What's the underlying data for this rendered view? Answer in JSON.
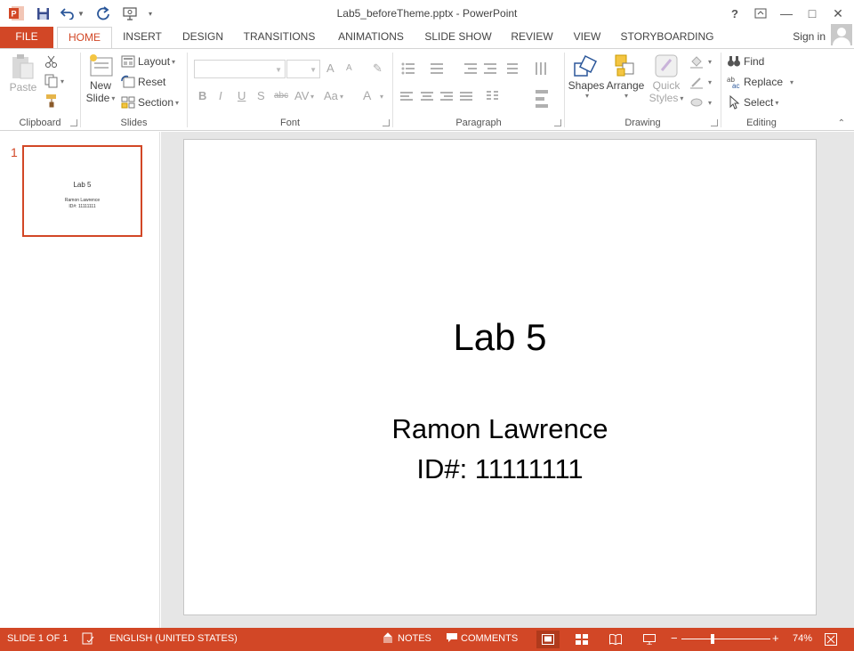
{
  "window": {
    "title": "Lab5_beforeTheme.pptx - PowerPoint",
    "help": "?",
    "minimize": "—",
    "maximize": "□",
    "close": "✕"
  },
  "tabs": [
    "FILE",
    "HOME",
    "INSERT",
    "DESIGN",
    "TRANSITIONS",
    "ANIMATIONS",
    "SLIDE SHOW",
    "REVIEW",
    "VIEW",
    "STORYBOARDING"
  ],
  "active_tab": "HOME",
  "signin": "Sign in",
  "ribbon": {
    "clipboard": {
      "paste": "Paste",
      "label": "Clipboard"
    },
    "slides": {
      "new_slide_line1": "New",
      "new_slide_line2": "Slide",
      "layout": "Layout",
      "reset": "Reset",
      "section": "Section",
      "label": "Slides"
    },
    "font": {
      "label": "Font",
      "bold": "B",
      "italic": "I",
      "underline": "U",
      "shadow": "S",
      "strike": "abc",
      "spacing": "AV",
      "case": "Aa",
      "color": "A",
      "grow": "A",
      "shrink": "A"
    },
    "paragraph": {
      "label": "Paragraph"
    },
    "drawing": {
      "shapes": "Shapes",
      "arrange": "Arrange",
      "quick_line1": "Quick",
      "quick_line2": "Styles",
      "label": "Drawing"
    },
    "editing": {
      "find": "Find",
      "replace": "Replace",
      "select": "Select",
      "label": "Editing"
    }
  },
  "thumbnails": [
    {
      "number": "1",
      "title": "Lab 5",
      "line1": "Ramon Lawrence",
      "line2": "ID#: 11111111"
    }
  ],
  "slide": {
    "title": "Lab 5",
    "subtitle_line1": "Ramon Lawrence",
    "subtitle_line2": "ID#: 11111111"
  },
  "status": {
    "slide_info": "SLIDE 1 OF 1",
    "language": "ENGLISH (UNITED STATES)",
    "notes": "NOTES",
    "comments": "COMMENTS",
    "zoom_minus": "−",
    "zoom_plus": "+",
    "zoom": "74%"
  },
  "colors": {
    "accent": "#d24726"
  }
}
